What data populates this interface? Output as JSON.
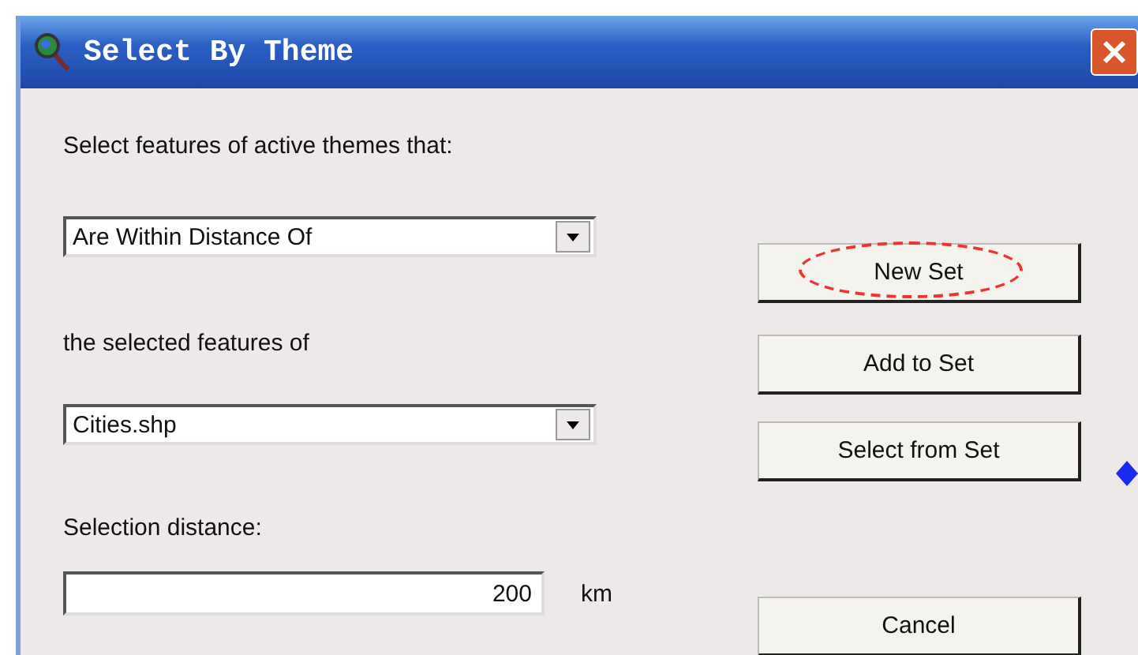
{
  "window": {
    "title": "Select By Theme"
  },
  "labels": [
    "Select features of active themes that:",
    "the selected features of",
    "Selection distance:"
  ],
  "relation_combo": {
    "value": "Are Within Distance Of"
  },
  "theme_combo": {
    "value": "Cities.shp"
  },
  "distance": {
    "value": "200",
    "unit": "km"
  },
  "buttons": [
    {
      "label": "New Set",
      "circled": true
    },
    {
      "label": "Add to Set",
      "circled": false
    },
    {
      "label": "Select from Set",
      "circled": false
    },
    {
      "label": "Cancel",
      "circled": false
    }
  ]
}
